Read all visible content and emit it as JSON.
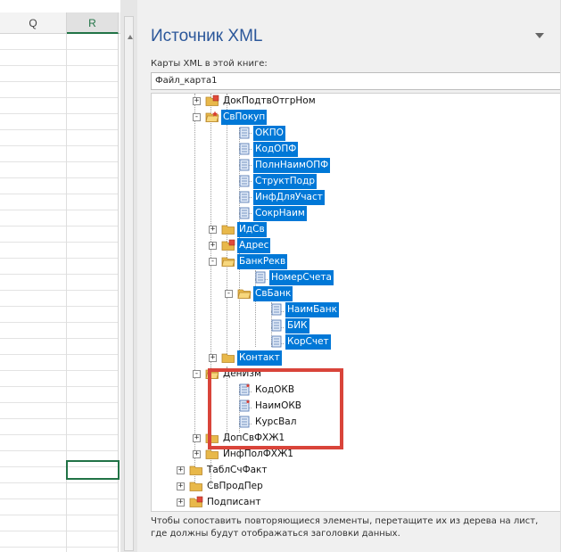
{
  "sheet": {
    "columns": [
      "Q",
      "R"
    ],
    "selected_column": "R"
  },
  "pane": {
    "title": "Источник XML",
    "maps_label": "Карты XML в этой книге:",
    "selected_map": "Файл_карта1",
    "footer": "Чтобы сопоставить повторяющиеся элементы, перетащите их из дерева на лист, где должны будут отображаться заголовки данных."
  },
  "tree": [
    {
      "label": "ДокПодтвОтгрНом",
      "icon": "folder-attr-icon",
      "toggle": "+",
      "selected": false
    },
    {
      "label": "СвПокуп",
      "icon": "folder-open-star-icon",
      "toggle": "-",
      "selected": true
    },
    {
      "label": "ОКПО",
      "icon": "element-icon",
      "toggle": "",
      "selected": true
    },
    {
      "label": "КодОПФ",
      "icon": "element-icon",
      "toggle": "",
      "selected": true
    },
    {
      "label": "ПолнНаимОПФ",
      "icon": "element-icon",
      "toggle": "",
      "selected": true
    },
    {
      "label": "СтруктПодр",
      "icon": "element-icon",
      "toggle": "",
      "selected": true
    },
    {
      "label": "ИнфДляУчаст",
      "icon": "element-icon",
      "toggle": "",
      "selected": true
    },
    {
      "label": "СокрНаим",
      "icon": "element-icon",
      "toggle": "",
      "selected": true
    },
    {
      "label": "ИдСв",
      "icon": "folder-icon",
      "toggle": "+",
      "selected": true
    },
    {
      "label": "Адрес",
      "icon": "folder-attr-icon",
      "toggle": "+",
      "selected": true
    },
    {
      "label": "БанкРекв",
      "icon": "folder-open-icon",
      "toggle": "-",
      "selected": true
    },
    {
      "label": "НомерСчета",
      "icon": "element-icon",
      "toggle": "",
      "selected": true
    },
    {
      "label": "СвБанк",
      "icon": "folder-open-icon",
      "toggle": "-",
      "selected": true
    },
    {
      "label": "НаимБанк",
      "icon": "element-icon",
      "toggle": "",
      "selected": true
    },
    {
      "label": "БИК",
      "icon": "element-icon",
      "toggle": "",
      "selected": true
    },
    {
      "label": "КорСчет",
      "icon": "element-icon",
      "toggle": "",
      "selected": true
    },
    {
      "label": "Контакт",
      "icon": "folder-icon",
      "toggle": "+",
      "selected": true
    },
    {
      "label": "ДенИзм",
      "icon": "folder-open-icon",
      "toggle": "-",
      "selected": false
    },
    {
      "label": "КодОКВ",
      "icon": "element-required-icon",
      "toggle": "",
      "selected": false
    },
    {
      "label": "НаимОКВ",
      "icon": "element-required-icon",
      "toggle": "",
      "selected": false
    },
    {
      "label": "КурсВал",
      "icon": "element-icon",
      "toggle": "",
      "selected": false
    },
    {
      "label": "ДопСвФХЖ1",
      "icon": "folder-icon",
      "toggle": "+",
      "selected": false
    },
    {
      "label": "ИнфПолФХЖ1",
      "icon": "folder-icon",
      "toggle": "+",
      "selected": false
    },
    {
      "label": "ТаблСчФакт",
      "icon": "folder-icon",
      "toggle": "+",
      "selected": false
    },
    {
      "label": "СвПродПер",
      "icon": "folder-icon",
      "toggle": "+",
      "selected": false
    },
    {
      "label": "Подписант",
      "icon": "folder-attr-icon",
      "toggle": "+",
      "selected": false
    }
  ]
}
